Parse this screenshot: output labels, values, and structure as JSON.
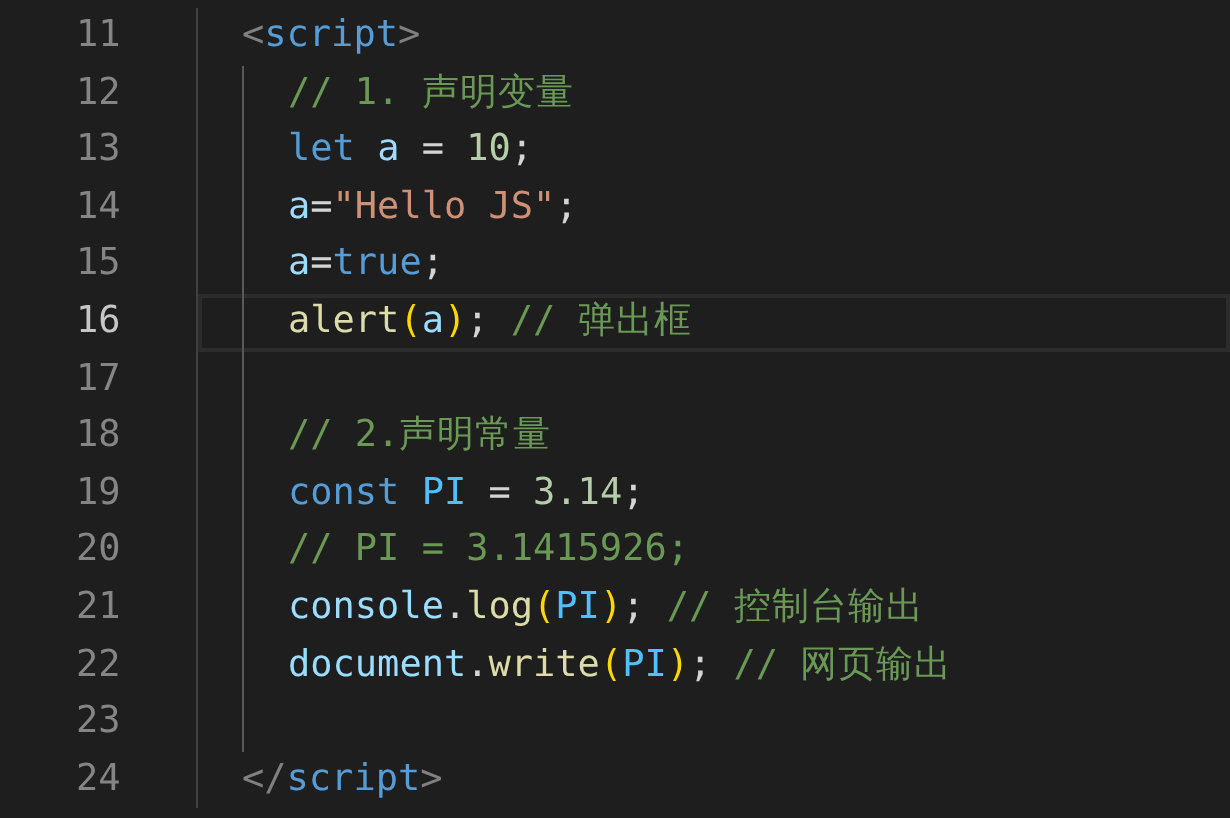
{
  "lines": [
    {
      "number": "11",
      "current": false,
      "tokens": [
        {
          "kind": "punct",
          "text": "<"
        },
        {
          "kind": "tag",
          "text": "script"
        },
        {
          "kind": "punct",
          "text": ">"
        }
      ],
      "children": [
        {
          "number": "12",
          "current": false,
          "tokens": [
            {
              "kind": "comment",
              "text": "// 1. 声明变量"
            }
          ]
        },
        {
          "number": "13",
          "current": false,
          "tokens": [
            {
              "kind": "keyword",
              "text": "let "
            },
            {
              "kind": "variable",
              "text": "a"
            },
            {
              "kind": "plain",
              "text": " = "
            },
            {
              "kind": "number",
              "text": "10"
            },
            {
              "kind": "plain",
              "text": ";"
            }
          ]
        },
        {
          "number": "14",
          "current": false,
          "tokens": [
            {
              "kind": "variable",
              "text": "a"
            },
            {
              "kind": "plain",
              "text": "="
            },
            {
              "kind": "string",
              "text": "\"Hello JS\""
            },
            {
              "kind": "plain",
              "text": ";"
            }
          ]
        },
        {
          "number": "15",
          "current": false,
          "tokens": [
            {
              "kind": "variable",
              "text": "a"
            },
            {
              "kind": "plain",
              "text": "="
            },
            {
              "kind": "keyword",
              "text": "true"
            },
            {
              "kind": "plain",
              "text": ";"
            }
          ]
        },
        {
          "number": "16",
          "current": true,
          "tokens": [
            {
              "kind": "function",
              "text": "alert"
            },
            {
              "kind": "bracket",
              "text": "("
            },
            {
              "kind": "variable",
              "text": "a"
            },
            {
              "kind": "bracket",
              "text": ")"
            },
            {
              "kind": "plain",
              "text": "; "
            },
            {
              "kind": "comment",
              "text": "// 弹出框"
            }
          ]
        },
        {
          "number": "17",
          "current": false
        },
        {
          "number": "18",
          "current": false,
          "tokens": [
            {
              "kind": "comment",
              "text": "// 2.声明常量"
            }
          ]
        },
        {
          "number": "19",
          "current": false,
          "tokens": [
            {
              "kind": "keyword",
              "text": "const "
            },
            {
              "kind": "constant",
              "text": "PI"
            },
            {
              "kind": "plain",
              "text": " = "
            },
            {
              "kind": "number",
              "text": "3.14"
            },
            {
              "kind": "plain",
              "text": ";"
            }
          ]
        },
        {
          "number": "20",
          "current": false,
          "tokens": [
            {
              "kind": "comment",
              "text": "// PI = 3.1415926;"
            }
          ]
        },
        {
          "number": "21",
          "current": false,
          "tokens": [
            {
              "kind": "variable",
              "text": "console"
            },
            {
              "kind": "plain",
              "text": "."
            },
            {
              "kind": "function",
              "text": "log"
            },
            {
              "kind": "bracket",
              "text": "("
            },
            {
              "kind": "constant",
              "text": "PI"
            },
            {
              "kind": "bracket",
              "text": ")"
            },
            {
              "kind": "plain",
              "text": "; "
            },
            {
              "kind": "comment",
              "text": "// 控制台输出"
            }
          ]
        },
        {
          "number": "22",
          "current": false,
          "tokens": [
            {
              "kind": "variable",
              "text": "document"
            },
            {
              "kind": "plain",
              "text": "."
            },
            {
              "kind": "function",
              "text": "write"
            },
            {
              "kind": "bracket",
              "text": "("
            },
            {
              "kind": "constant",
              "text": "PI"
            },
            {
              "kind": "bracket",
              "text": ")"
            },
            {
              "kind": "plain",
              "text": "; "
            },
            {
              "kind": "comment",
              "text": "// 网页输出"
            }
          ]
        },
        {
          "number": "23",
          "current": false
        }
      ]
    },
    {
      "number": "24",
      "current": false,
      "tokens": [
        {
          "kind": "punct",
          "text": "</"
        },
        {
          "kind": "tag",
          "text": "script"
        },
        {
          "kind": "punct",
          "text": ">"
        }
      ]
    }
  ]
}
